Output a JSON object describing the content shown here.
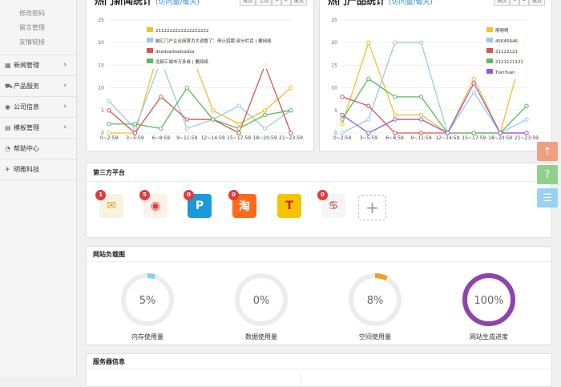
{
  "sidebar": {
    "sub_items": [
      "修改密码",
      "留言管理",
      "友情链接"
    ],
    "nav": [
      {
        "icon": "grid-icon",
        "glyph": "▦",
        "label": "新闻管理",
        "chevron": true
      },
      {
        "icon": "cart-icon",
        "glyph": "⛟",
        "label": "产品服务",
        "chevron": true
      },
      {
        "icon": "info-icon",
        "glyph": "◉",
        "label": "公司信息",
        "chevron": true
      },
      {
        "icon": "template-icon",
        "glyph": "▤",
        "label": "模板管理",
        "chevron": true
      },
      {
        "icon": "help-icon",
        "glyph": "◔",
        "label": "帮助中心",
        "chevron": false
      },
      {
        "icon": "brand-icon",
        "glyph": "✈",
        "label": "明雅科技",
        "chevron": false
      }
    ]
  },
  "news_chart": {
    "title": "热门新闻统计",
    "subtitle": "(访问量/每天)",
    "pager": [
      "首页",
      "上页",
      "1",
      "2",
      "尾页"
    ],
    "chart_data": {
      "type": "line",
      "categories": [
        "0~2:59",
        "3~5:59",
        "6~8:59",
        "9~11:59",
        "12~14:59",
        "15~17:59",
        "18~20:59",
        "21~23:59"
      ],
      "ylim": [
        0,
        25
      ],
      "yticks": [
        0,
        5,
        10,
        15,
        20,
        25
      ],
      "series": [
        {
          "name": "2112222222222222222",
          "color": "#f0c030",
          "values": [
            0,
            0,
            20,
            20,
            5,
            2,
            5,
            10
          ]
        },
        {
          "name": "融汇门户企业网首页大调整了：停止招聘 部分栏目 | 要网络",
          "color": "#9cc8ec",
          "values": [
            7,
            1,
            16,
            1,
            3,
            6,
            1,
            5
          ]
        },
        {
          "name": "dsadsadsadsadsa",
          "color": "#d9534f",
          "values": [
            5,
            0,
            8,
            3,
            3,
            0,
            15,
            0
          ]
        },
        {
          "name": "龙颜汇城市万多券 | 要网络",
          "color": "#5cb85c",
          "values": [
            2,
            2,
            1,
            10,
            3,
            1,
            4,
            5
          ]
        }
      ]
    }
  },
  "product_chart": {
    "title": "热门产品统计",
    "subtitle": "(访问量/每天)",
    "pager": [
      "首页",
      "1",
      "2",
      "尾页"
    ],
    "chart_data": {
      "type": "line",
      "categories": [
        "0~2:59",
        "3~5:59",
        "6~8:59",
        "9~11:59",
        "12~14:59",
        "15~17:59",
        "18~20:59",
        "21~23:59"
      ],
      "ylim": [
        0,
        25
      ],
      "yticks": [
        0,
        5,
        10,
        15,
        20,
        25
      ],
      "series": [
        {
          "name": "啊啊啊",
          "color": "#f0c030",
          "values": [
            2,
            20,
            4,
            4,
            0,
            12,
            0,
            21
          ]
        },
        {
          "name": "45645646",
          "color": "#9cc8ec",
          "values": [
            0,
            3,
            20,
            20,
            0,
            9,
            0,
            3
          ]
        },
        {
          "name": "21122121",
          "color": "#d9534f",
          "values": [
            8,
            6,
            0,
            0,
            0,
            0,
            0,
            0
          ]
        },
        {
          "name": "2121121121",
          "color": "#5cb85c",
          "values": [
            3,
            12,
            8,
            8,
            0,
            0,
            0,
            6
          ]
        },
        {
          "name": "TianYuan",
          "color": "#9b59d0",
          "values": [
            4,
            0,
            3,
            3,
            0,
            11,
            0,
            0
          ]
        }
      ]
    }
  },
  "third_party": {
    "title": "第三方平台",
    "icons": [
      {
        "name": "mail-icon",
        "glyph": "✉",
        "badge": "1",
        "bg": "#f7f3e0",
        "fg": "#e0a020"
      },
      {
        "name": "weibo-icon",
        "glyph": "◉",
        "badge": "5",
        "bg": "#fff0e8",
        "fg": "#e03a3a"
      },
      {
        "name": "pin-icon",
        "glyph": "P",
        "badge": "0",
        "bg": "#1a9ad8",
        "fg": "#ffffff"
      },
      {
        "name": "taobao-icon",
        "glyph": "淘",
        "badge": "0",
        "bg": "#ff6a1a",
        "fg": "#ffffff"
      },
      {
        "name": "t-icon",
        "glyph": "T",
        "badge": "",
        "bg": "#f5c400",
        "fg": "#d02020"
      },
      {
        "name": "fish-icon",
        "glyph": "♋",
        "badge": "0",
        "bg": "#f5f5f5",
        "fg": "#d02020"
      }
    ],
    "add_glyph": "+"
  },
  "load_chart": {
    "title": "网站负载图",
    "gauges": [
      {
        "label": "内存使用量",
        "value": 5,
        "text": "5%",
        "color": "#8ecbf0"
      },
      {
        "label": "数据使用量",
        "value": 0,
        "text": "0%",
        "color": "#8ecbf0"
      },
      {
        "label": "空间使用量",
        "value": 8,
        "text": "8%",
        "color": "#f0a020"
      },
      {
        "label": "网站生成进度",
        "value": 100,
        "text": "100%",
        "color": "#8e44ad"
      }
    ]
  },
  "server_info": {
    "title": "服务器信息"
  },
  "float_buttons": [
    {
      "name": "back-to-top-icon",
      "glyph": "⇡",
      "color": "#f0a080"
    },
    {
      "name": "help-question-icon",
      "glyph": "?",
      "color": "#8fd08f"
    },
    {
      "name": "chat-icon",
      "glyph": "☰",
      "color": "#9ad0f0"
    }
  ]
}
